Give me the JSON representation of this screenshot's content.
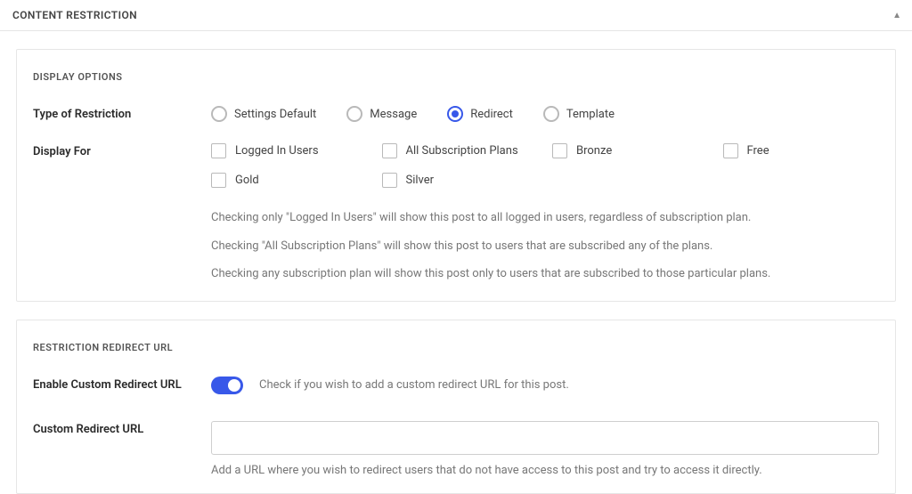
{
  "panel": {
    "title": "CONTENT RESTRICTION"
  },
  "displayOptions": {
    "title": "DISPLAY OPTIONS",
    "typeOfRestriction": {
      "label": "Type of Restriction",
      "options": {
        "settingsDefault": "Settings Default",
        "message": "Message",
        "redirect": "Redirect",
        "template": "Template"
      },
      "selected": "redirect"
    },
    "displayFor": {
      "label": "Display For",
      "options": {
        "loggedIn": "Logged In Users",
        "allSubs": "All Subscription Plans",
        "bronze": "Bronze",
        "free": "Free",
        "gold": "Gold",
        "silver": "Silver"
      },
      "help1": "Checking only \"Logged In Users\" will show this post to all logged in users, regardless of subscription plan.",
      "help2": "Checking \"All Subscription Plans\" will show this post to users that are subscribed any of the plans.",
      "help3": "Checking any subscription plan will show this post only to users that are subscribed to those particular plans."
    }
  },
  "redirectSection": {
    "title": "RESTRICTION REDIRECT URL",
    "enable": {
      "label": "Enable Custom Redirect URL",
      "help": "Check if you wish to add a custom redirect URL for this post.",
      "on": true
    },
    "customUrl": {
      "label": "Custom Redirect URL",
      "value": "",
      "help": "Add a URL where you wish to redirect users that do not have access to this post and try to access it directly."
    }
  }
}
